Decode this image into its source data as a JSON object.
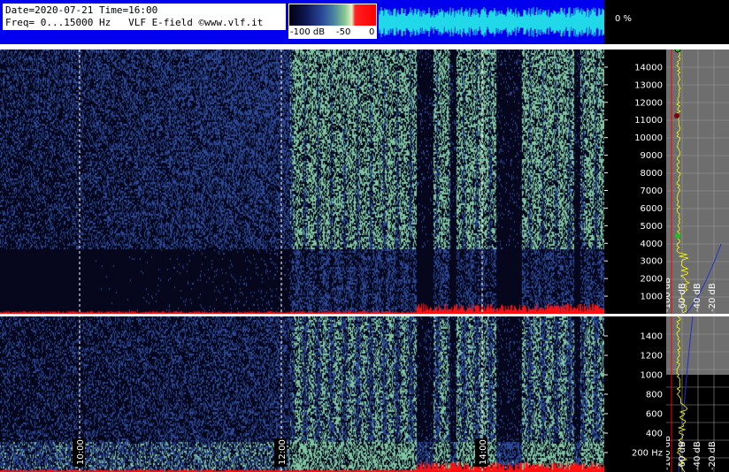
{
  "header": {
    "line1": "Date=2020-07-21 Time=16:00",
    "line2": "Freq= 0...15000 Hz   VLF E-field ©www.vlf.it",
    "percent": "0 %"
  },
  "colorbar": {
    "labels": [
      "-100 dB",
      "-50",
      "0"
    ]
  },
  "colors": {
    "header_bg": "#0000ee",
    "spectrogram_low": "#06071c",
    "spectrogram_mid": "#2c4896",
    "spectrogram_high": "#7fc3a0",
    "hot": "#ff1010",
    "waveform": "#20d8e8",
    "profile_line": "#ffff00",
    "profile_red": "#ff0000",
    "profile_blue": "#2030d0"
  },
  "chart_data": [
    {
      "type": "heatmap",
      "name": "spectrogram-upper",
      "x_tick_labels": [
        "10:00",
        "12:00",
        "14:00"
      ],
      "ylabel": "",
      "y_ticks": [
        1000,
        2000,
        3000,
        4000,
        5000,
        6000,
        7000,
        8000,
        9000,
        10000,
        11000,
        12000,
        13000,
        14000
      ],
      "ylim": [
        0,
        15000
      ],
      "intensity_scale_db": [
        -100,
        0
      ],
      "profile_db_labels": [
        "-100 dB",
        "-60 dB",
        "-40 dB",
        "-20 dB"
      ]
    },
    {
      "type": "heatmap",
      "name": "spectrogram-lower",
      "x_tick_labels": [
        "10:00",
        "12:00",
        "14:00"
      ],
      "y_ticks": [
        200,
        400,
        600,
        800,
        1000,
        1200,
        1400
      ],
      "y_unit": "Hz",
      "ylim": [
        0,
        1600
      ],
      "intensity_scale_db": [
        -100,
        0
      ],
      "profile_db_labels": [
        "-100 dB",
        "-60 dB",
        "-40 dB",
        "-20 dB"
      ]
    }
  ]
}
